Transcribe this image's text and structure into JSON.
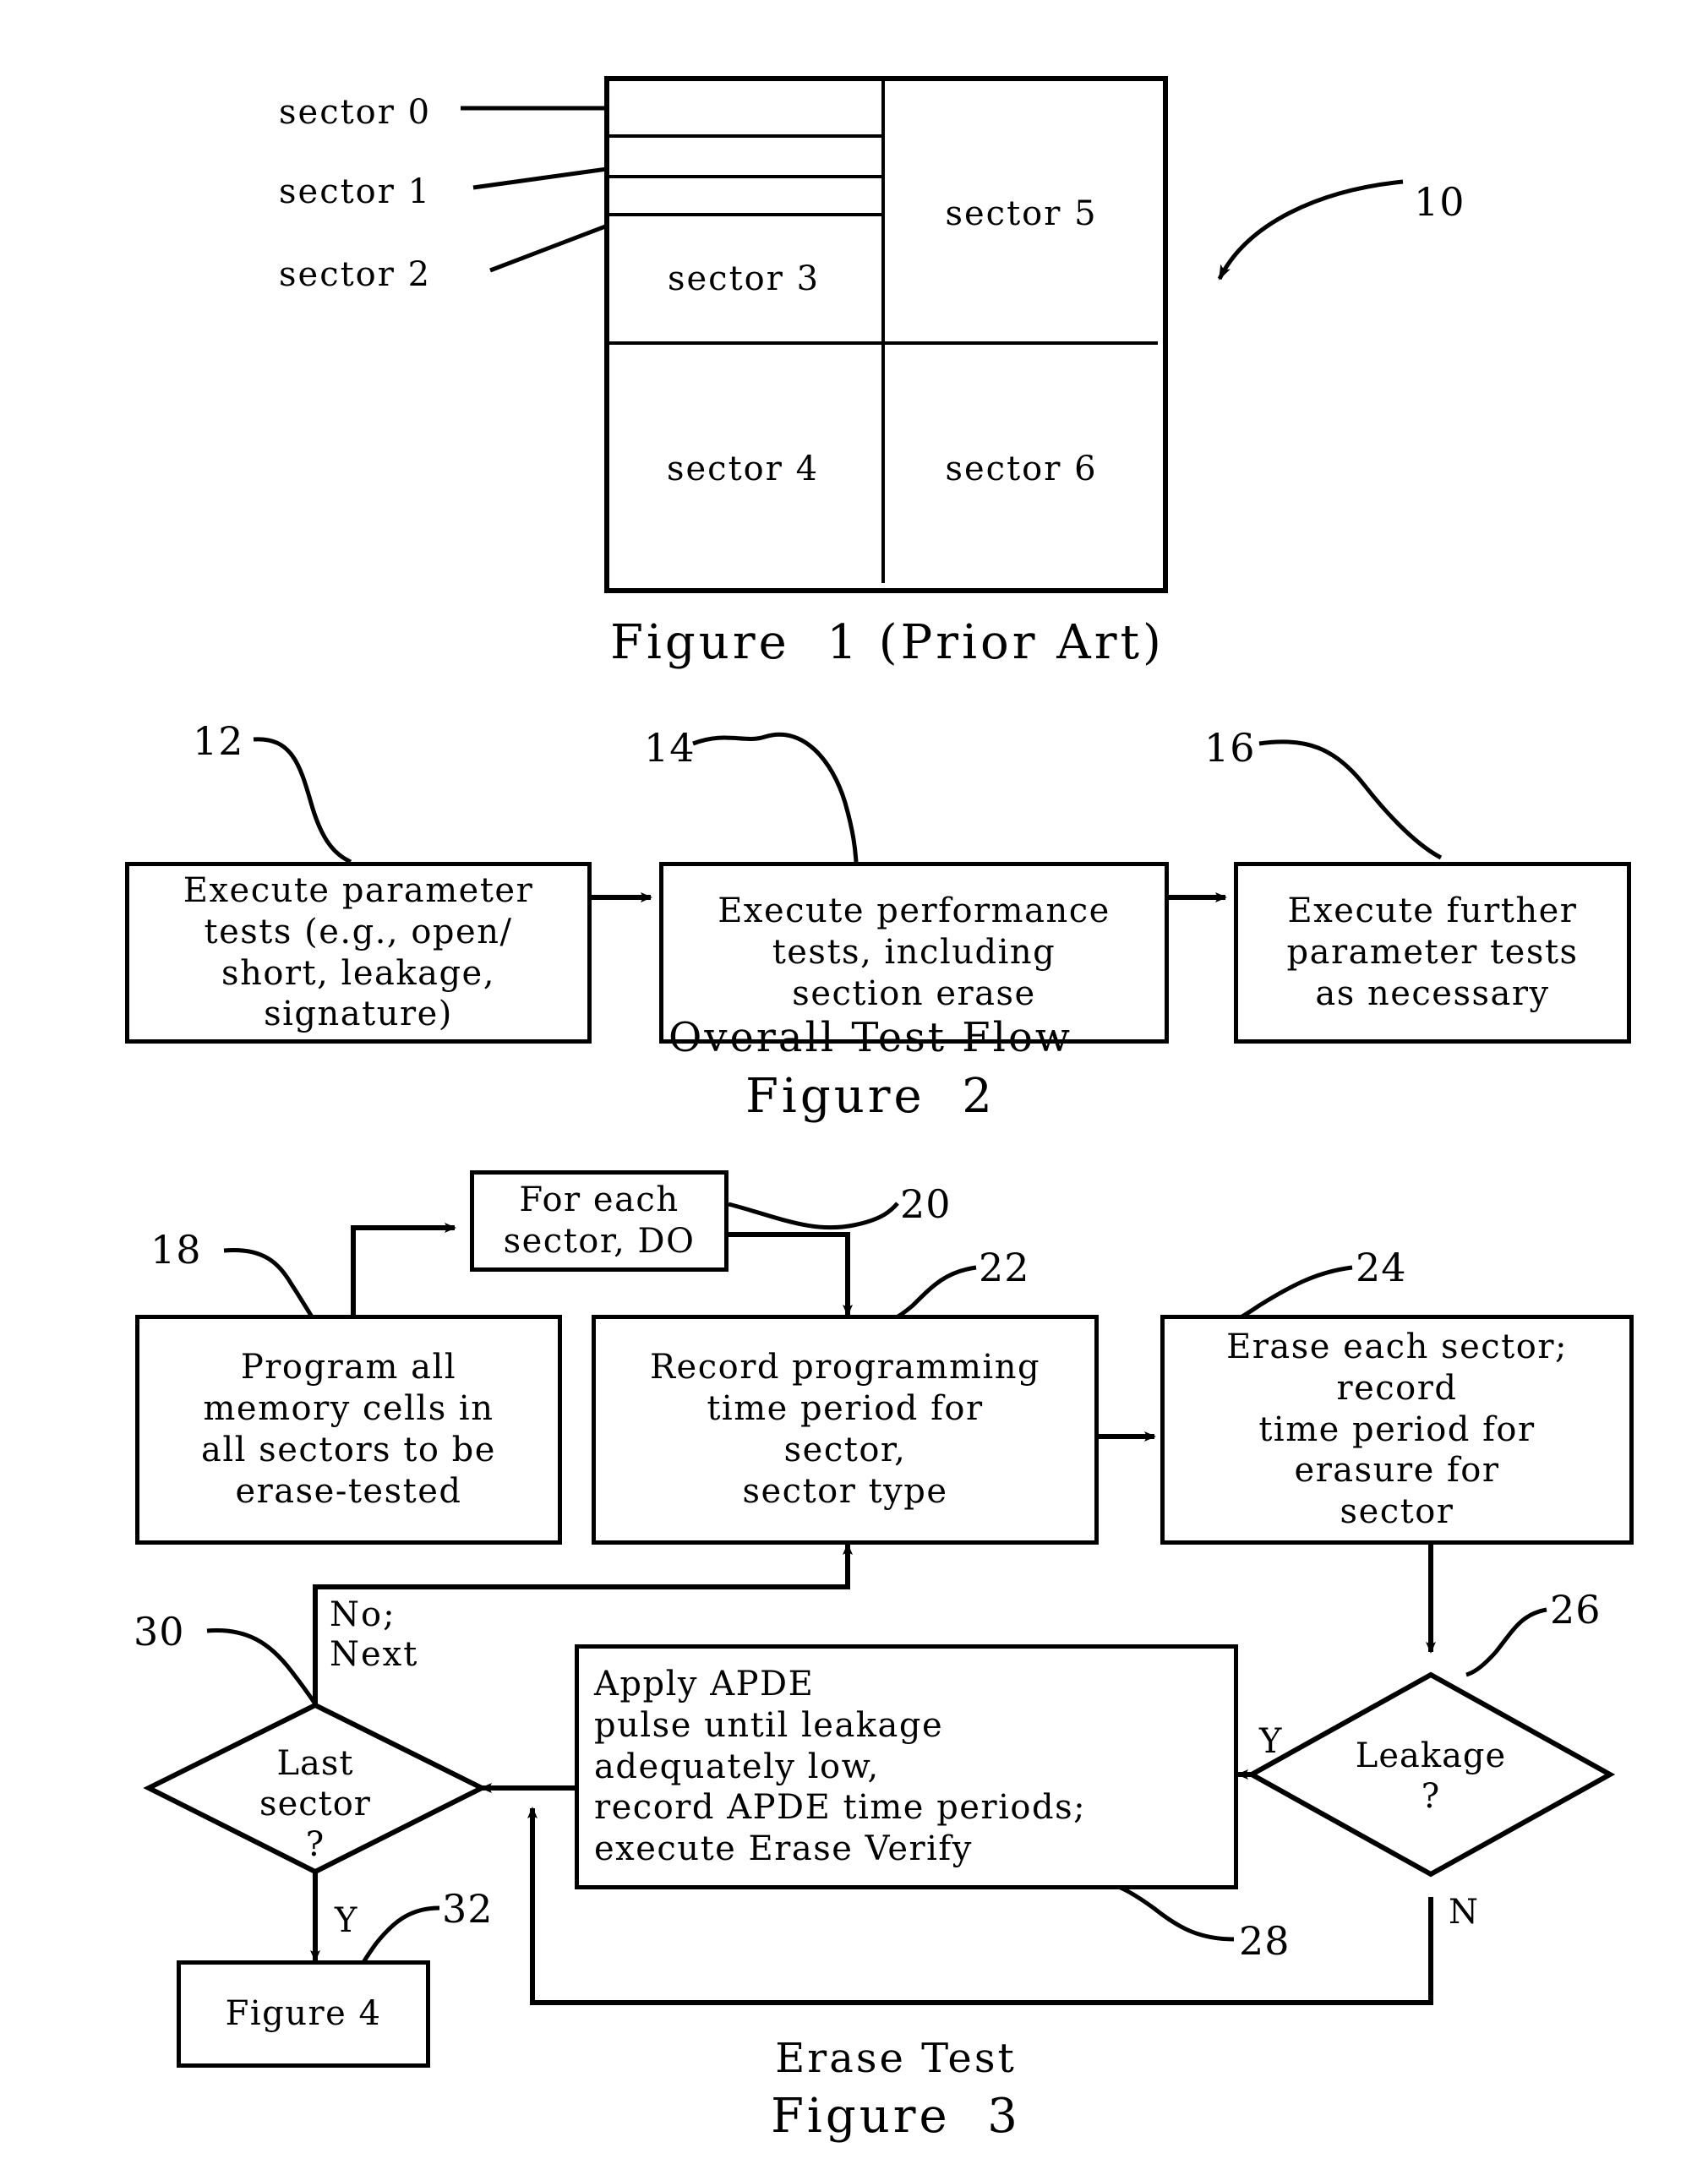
{
  "figure1": {
    "caption": "Figure  1 (Prior Art)",
    "reference": "10",
    "callouts": [
      {
        "label": "sector 0"
      },
      {
        "label": "sector 1"
      },
      {
        "label": "sector 2"
      }
    ],
    "cells": [
      {
        "label": "sector 3"
      },
      {
        "label": "sector 5"
      },
      {
        "label": "sector 4"
      },
      {
        "label": "sector 6"
      }
    ]
  },
  "figure2": {
    "subtitle": "Overall Test Flow",
    "caption": "Figure  2",
    "refs": {
      "b12": "12",
      "b14": "14",
      "b16": "16"
    },
    "boxes": [
      {
        "id": "b12",
        "text": "Execute parameter\ntests (e.g., open/\nshort, leakage,\nsignature)"
      },
      {
        "id": "b14",
        "text": "Execute performance\ntests, including\nsection erase"
      },
      {
        "id": "b16",
        "text": "Execute further\nparameter tests\nas necessary"
      }
    ]
  },
  "figure3": {
    "subtitle": "Erase Test",
    "caption": "Figure  3",
    "refs": {
      "b18": "18",
      "b20": "20",
      "b22": "22",
      "b24": "24",
      "b26": "26",
      "b28": "28",
      "b30": "30",
      "b32": "32"
    },
    "boxes": [
      {
        "id": "b20",
        "text": "For  each\nsector, DO"
      },
      {
        "id": "b18",
        "text": "Program all\nmemory cells in\nall sectors to be\nerase-tested"
      },
      {
        "id": "b22",
        "text": "Record programming\ntime period for\nsector,\nsector type"
      },
      {
        "id": "b24",
        "text": "Erase each sector;\nrecord\ntime period for\nerasure for\nsector"
      },
      {
        "id": "b28",
        "text": "Apply APDE\npulse until leakage\nadequately low,\nrecord APDE time periods;\nexecute Erase Verify"
      },
      {
        "id": "b32",
        "text": "Figure 4"
      }
    ],
    "decisions": [
      {
        "id": "b30",
        "text": "Last\nsector\n?"
      },
      {
        "id": "b26",
        "text": "Leakage\n?"
      }
    ],
    "edge_labels": {
      "no_next": "No;\nNext",
      "yes_last": "Y",
      "yes_leak": "Y",
      "no_leak": "N"
    }
  },
  "colors": {
    "ink": "#000000",
    "paper": "#ffffff"
  }
}
